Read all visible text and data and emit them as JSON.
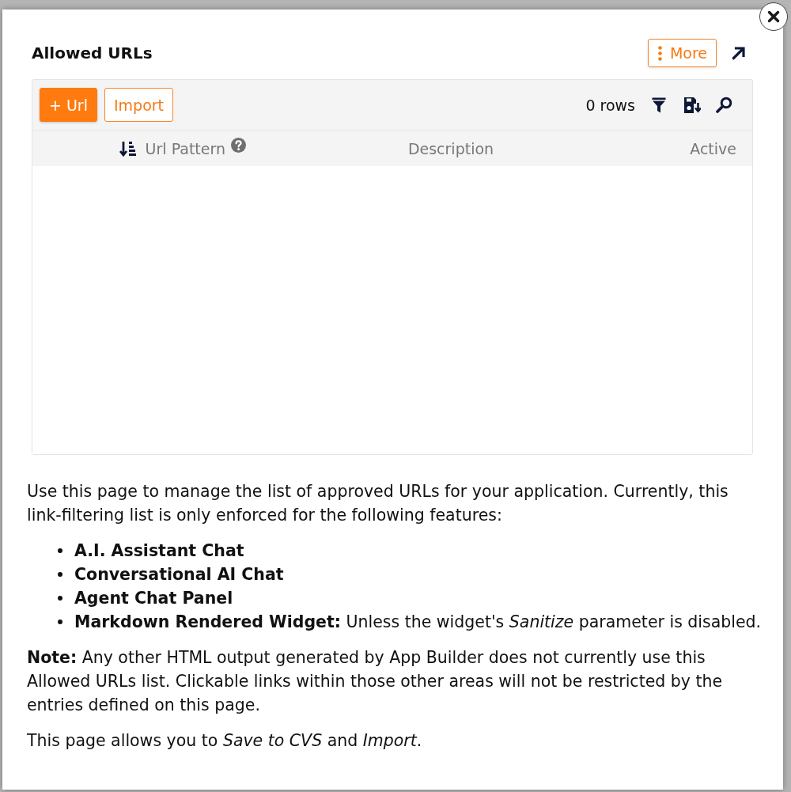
{
  "dialog": {
    "title": "Allowed URLs",
    "more_button": {
      "label": "More"
    }
  },
  "toolbar": {
    "buttons": [
      {
        "label": "+ Url",
        "kind": "primary"
      },
      {
        "label": "Import",
        "kind": "secondary"
      }
    ],
    "row_count": "0 rows"
  },
  "table": {
    "columns": [
      {
        "label": "Url Pattern",
        "sorted": true,
        "help": true
      },
      {
        "label": "Description",
        "sorted": false,
        "help": false
      },
      {
        "label": "Active",
        "sorted": false,
        "help": false
      }
    ]
  },
  "help_text": {
    "intro": "Use this page to manage the list of approved URLs for your application. Currently, this link-filtering list is only enforced for the following features:",
    "features": [
      {
        "name": "A.I. Assistant Chat"
      },
      {
        "name": "Conversational AI Chat"
      },
      {
        "name": "Agent Chat Panel"
      },
      {
        "name": "Markdown Rendered Widget:",
        "detail": "Unless the widget's *Sanitize* parameter is disabled."
      }
    ],
    "note": "**Note:** Any other HTML output generated by App Builder does not currently use this Allowed URLs list. Clickable links within those other areas will not be restricted by the entries defined on this page.",
    "footer": "This page allows you to *Save to CVS* and *Import*."
  }
}
